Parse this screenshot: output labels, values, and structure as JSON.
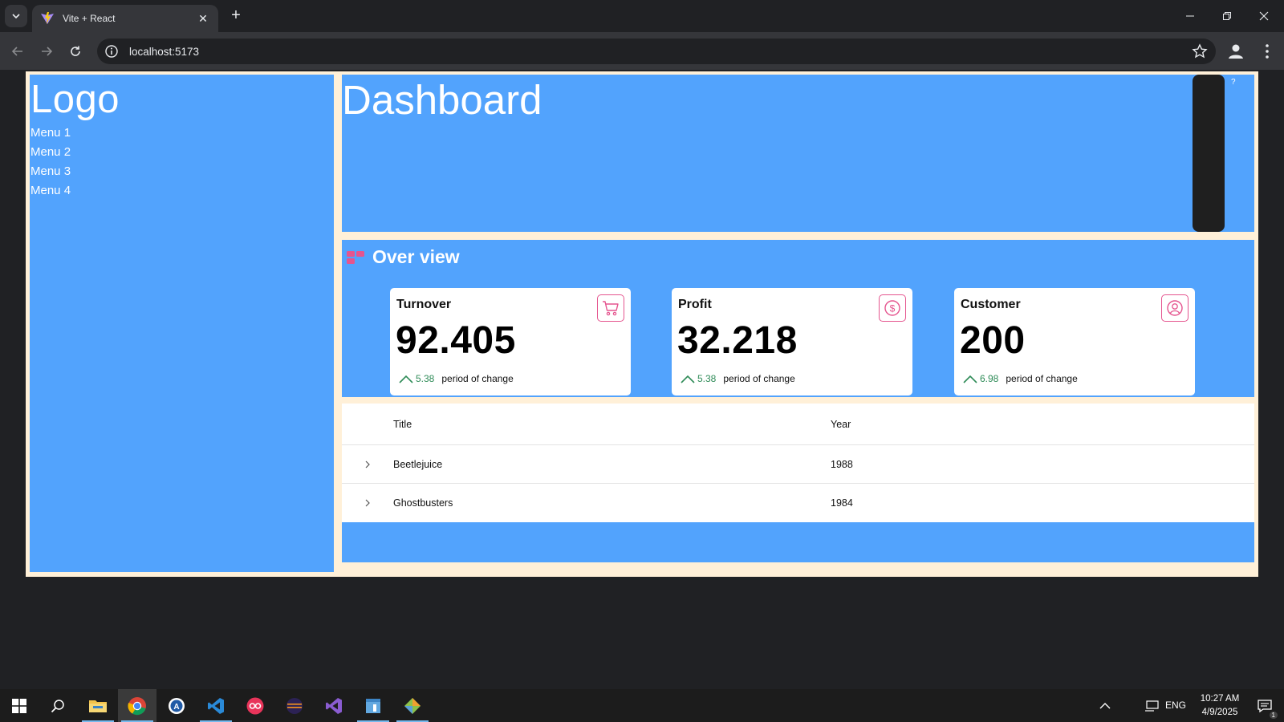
{
  "browser": {
    "tab_title": "Vite + React",
    "url": "localhost:5173"
  },
  "sidebar": {
    "logo": "Logo",
    "menu": [
      {
        "label": "Menu 1"
      },
      {
        "label": "Menu 2"
      },
      {
        "label": "Menu 3"
      },
      {
        "label": "Menu 4"
      }
    ]
  },
  "header": {
    "title": "Dashboard",
    "help_mark": "?"
  },
  "overview": {
    "title": "Over view",
    "cards": [
      {
        "label": "Turnover",
        "value": "92.405",
        "change": "5.38",
        "change_text": "period of change",
        "icon": "shopping-cart-icon"
      },
      {
        "label": "Profit",
        "value": "32.218",
        "change": "5.38",
        "change_text": "period of change",
        "icon": "dollar-circle-icon"
      },
      {
        "label": "Customer",
        "value": "200",
        "change": "6.98",
        "change_text": "period of change",
        "icon": "user-circle-icon"
      }
    ]
  },
  "table": {
    "columns": [
      "Title",
      "Year"
    ],
    "rows": [
      {
        "title": "Beetlejuice",
        "year": "1988"
      },
      {
        "title": "Ghostbusters",
        "year": "1984"
      }
    ]
  },
  "taskbar": {
    "language": "ENG",
    "time": "10:27 AM",
    "date": "4/9/2025",
    "notification_count": "1"
  },
  "colors": {
    "panel_blue": "#52a3fd",
    "frame_cream": "#fff0d8",
    "accent_pink": "#e5558f",
    "trend_green": "#2e8b57"
  }
}
